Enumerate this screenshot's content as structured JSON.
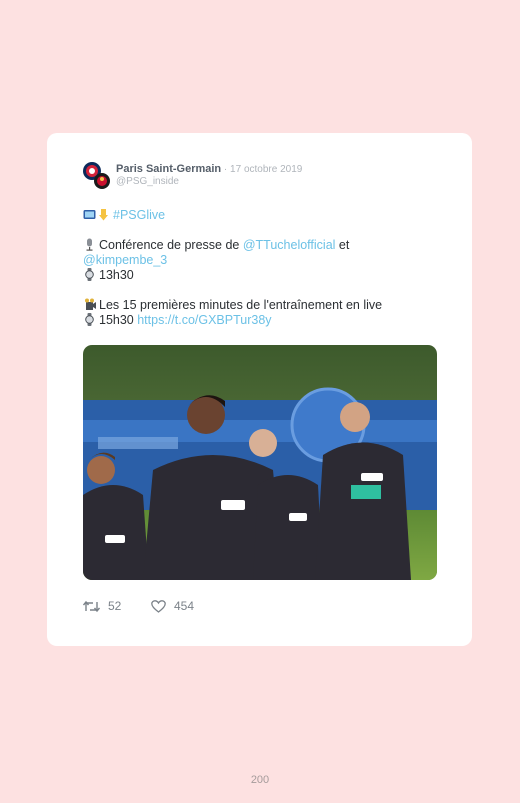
{
  "tweet": {
    "author_name": "Paris Saint-Germain",
    "separator": " · ",
    "date": "17 octobre 2019",
    "handle": "@PSG_inside",
    "hashtag": "#PSGlive",
    "line_conf_prefix": "Conférence de presse de ",
    "mention_1": "@TTuchelofficial",
    "line_conf_suffix": " et",
    "mention_2": "@kimpembe_3",
    "time_1": "13h30",
    "line_training": "Les 15 premières minutes de l'entraînement en live",
    "time_2_prefix": "15h30 ",
    "link": "https://t.co/GXBPTur38y",
    "retweets": "52",
    "likes": "454"
  },
  "icons": {
    "tv": "tv-icon",
    "pointing_down": "pointing-down-icon",
    "microphone": "microphone-icon",
    "watch": "watch-icon",
    "camera": "movie-camera-icon",
    "retweet": "retweet-icon",
    "heart": "heart-icon"
  },
  "colors": {
    "background": "#fde1e1",
    "link": "#6cc1e6",
    "psg_navy": "#0b2a5b",
    "psg_red": "#d4223a"
  },
  "page_number": "200"
}
